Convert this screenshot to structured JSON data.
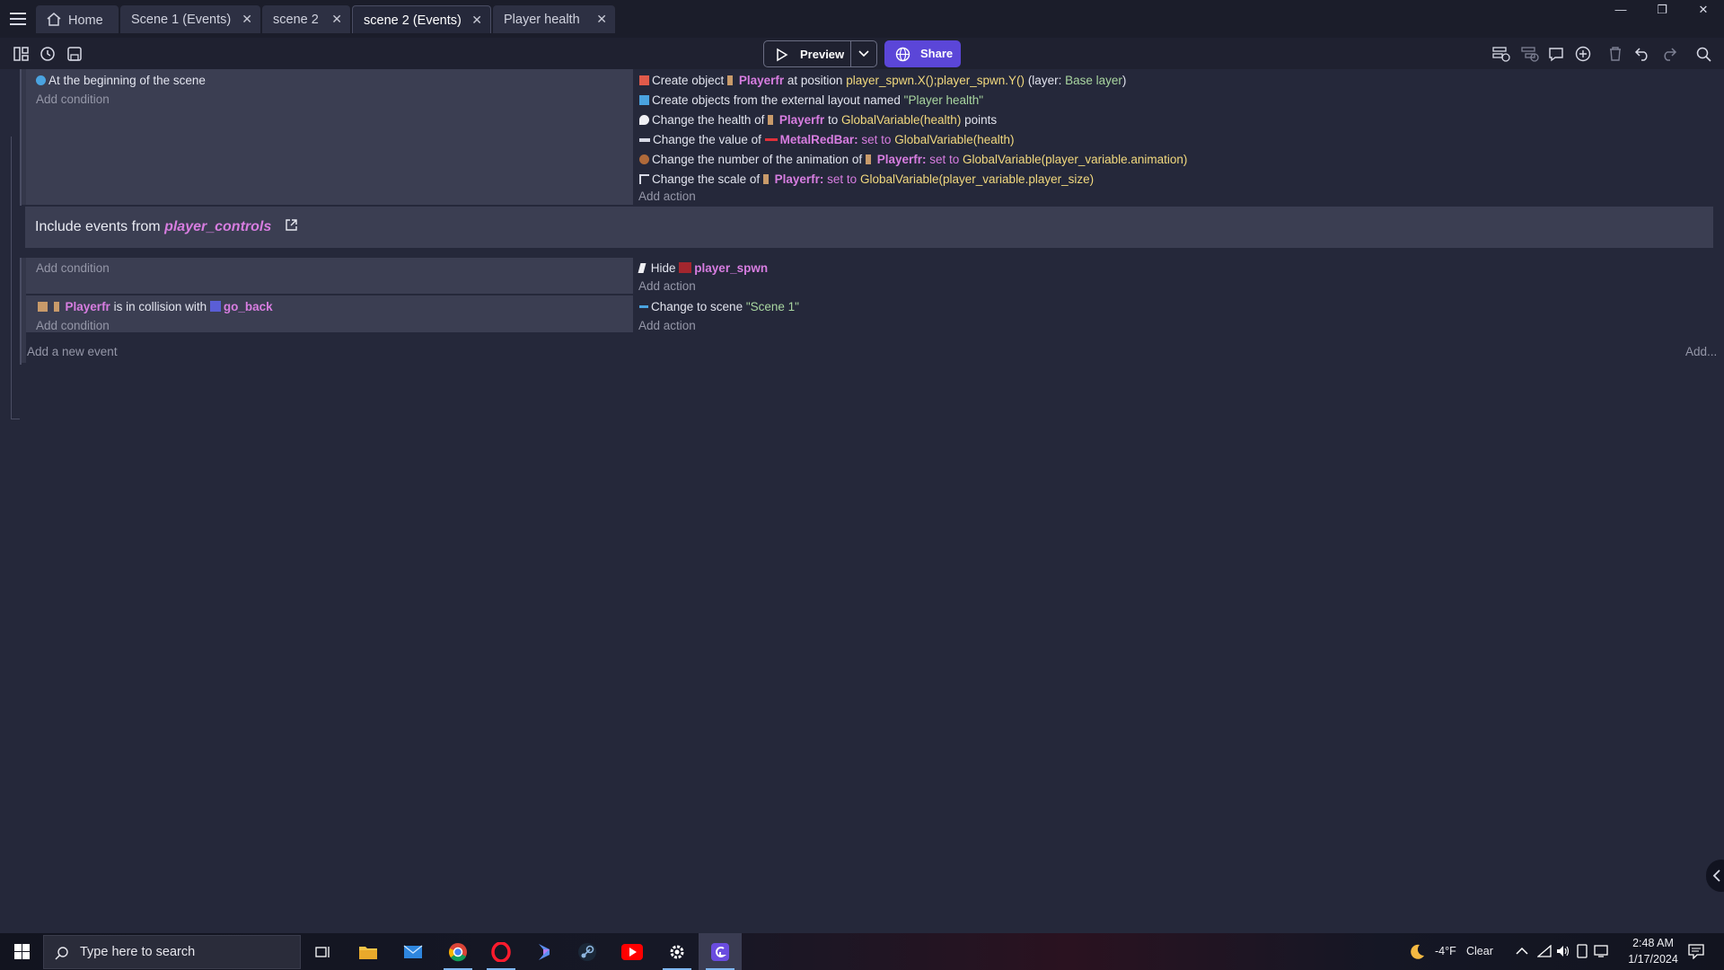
{
  "tabs": [
    {
      "label": "Home",
      "closable": false
    },
    {
      "label": "Scene 1 (Events)",
      "closable": true
    },
    {
      "label": "scene 2",
      "closable": true
    },
    {
      "label": "scene 2 (Events)",
      "closable": true,
      "active": true
    },
    {
      "label": "Player health",
      "closable": true
    }
  ],
  "toolbar": {
    "preview_label": "Preview",
    "share_label": "Share"
  },
  "events": {
    "event1": {
      "condition": "At the beginning of the scene",
      "add_condition": "Add condition",
      "actions": [
        {
          "prefix": "Create object",
          "object": "Playerfr",
          "mid": "at position",
          "param": "player_spwn.X();player_spwn.Y()",
          "suffix_pre": "(layer:",
          "suffix_val": "Base layer",
          "suffix_post": ")"
        },
        {
          "prefix": "Create objects from the external layout named",
          "string": "\"Player health\""
        },
        {
          "prefix": "Change the health of",
          "object": "Playerfr",
          "mid": "to",
          "param": "GlobalVariable(health)",
          "suffix": "points"
        },
        {
          "prefix": "Change the value of",
          "object": "MetalRedBar:",
          "kw": "set to",
          "param": "GlobalVariable(health)"
        },
        {
          "prefix": "Change the number of the animation of",
          "object": "Playerfr:",
          "kw": "set to",
          "param": "GlobalVariable(player_variable.animation)"
        },
        {
          "prefix": "Change the scale of",
          "object": "Playerfr:",
          "kw": "set to",
          "param": "GlobalVariable(player_variable.player_size)"
        }
      ],
      "add_action": "Add action"
    },
    "include": {
      "label": "Include events from",
      "external": "player_controls"
    },
    "event2": {
      "add_condition": "Add condition",
      "action_verb": "Hide",
      "action_object": "player_spwn",
      "add_action": "Add action"
    },
    "event3": {
      "cond_object": "Playerfr",
      "cond_mid": "is in collision with",
      "cond_target": "go_back",
      "add_condition": "Add condition",
      "action_prefix": "Change to scene",
      "action_string": "\"Scene 1\"",
      "add_action": "Add action"
    },
    "add_new_event": "Add a new event",
    "add_more": "Add..."
  },
  "taskbar": {
    "search_placeholder": "Type here to search",
    "weather_temp": "-4°F",
    "weather_text": "Clear",
    "time": "2:48 AM",
    "date": "1/17/2024"
  },
  "colors": {
    "accent": "#5b46d8",
    "object": "#d77de0",
    "param": "#f2d97e",
    "string": "#a9d6a0"
  }
}
